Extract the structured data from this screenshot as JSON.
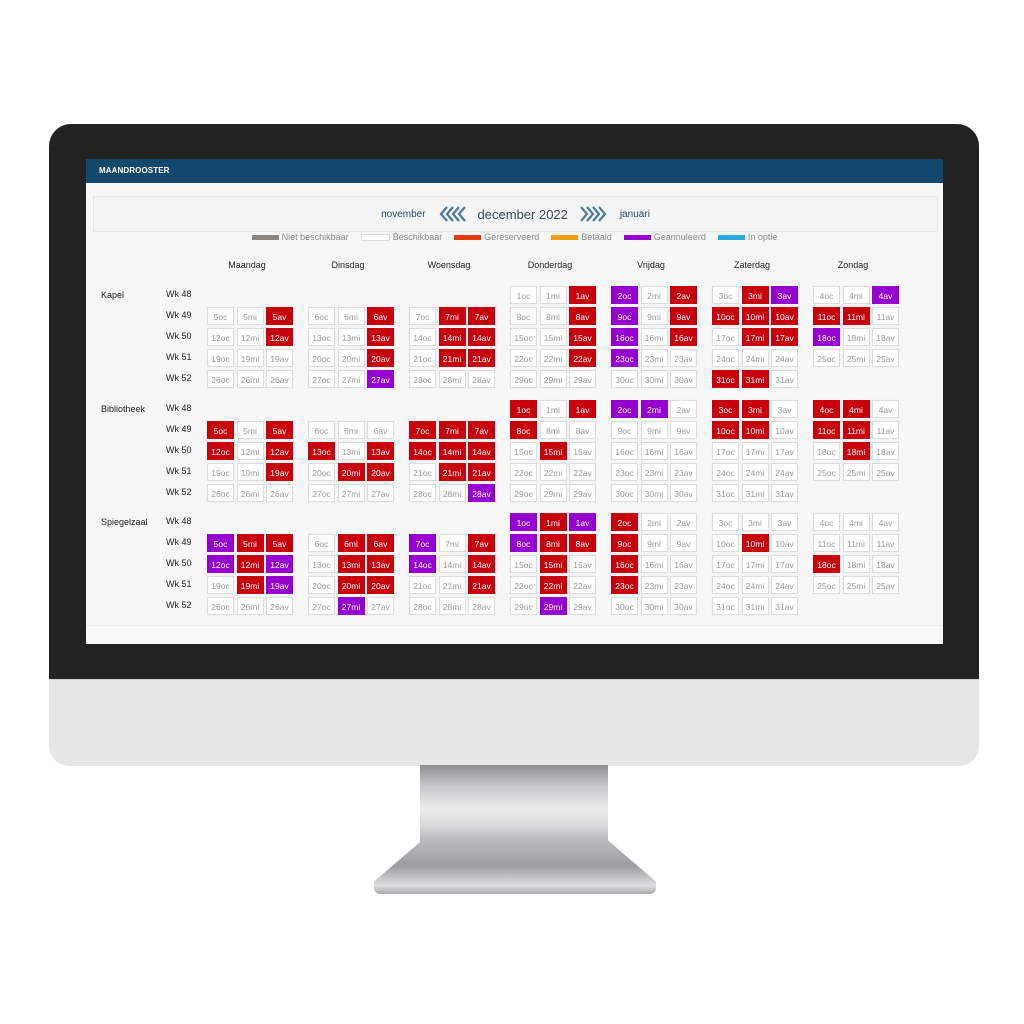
{
  "window": {
    "title": "MAANDROOSTER"
  },
  "navigation": {
    "prev_month": "november",
    "current_month": "december 2022",
    "next_month": "januari",
    "prev_icon": "triple-chevron-left-icon",
    "next_icon": "triple-chevron-right-icon"
  },
  "colors": {
    "header": "#13486e",
    "reserved": "#c8020c",
    "cancelled": "#9500d1"
  },
  "legend": [
    {
      "label": "Niet beschikbaar",
      "color": "#8c8580",
      "status": "unavailable"
    },
    {
      "label": "Beschikbaar",
      "color": "#ffffff",
      "status": "available"
    },
    {
      "label": "Gereserveerd",
      "color": "#e8390e",
      "status": "reserved"
    },
    {
      "label": "Betaald",
      "color": "#f39c12",
      "status": "paid"
    },
    {
      "label": "Geannuleerd",
      "color": "#9500d1",
      "status": "cancelled"
    },
    {
      "label": "In optie",
      "color": "#29abe2",
      "status": "option"
    }
  ],
  "days": [
    "Maandag",
    "Dinsdag",
    "Woensdag",
    "Donderdag",
    "Vrijdag",
    "Zaterdag",
    "Zondag"
  ],
  "slots": [
    "oc",
    "mi",
    "av"
  ],
  "weeks": [
    {
      "label": "Wk 48",
      "dates": [
        null,
        null,
        null,
        1,
        2,
        3,
        4
      ]
    },
    {
      "label": "Wk 49",
      "dates": [
        5,
        6,
        7,
        8,
        9,
        10,
        11
      ]
    },
    {
      "label": "Wk 50",
      "dates": [
        12,
        13,
        14,
        15,
        16,
        17,
        18
      ]
    },
    {
      "label": "Wk 51",
      "dates": [
        19,
        20,
        21,
        22,
        23,
        24,
        25
      ]
    },
    {
      "label": "Wk 52",
      "dates": [
        26,
        27,
        28,
        29,
        30,
        31,
        null
      ]
    }
  ],
  "rooms": [
    {
      "name": "Kapel",
      "reserved": [
        "1av",
        "3mi",
        "2av",
        "5av",
        "6av",
        "7mi",
        "7av",
        "8av",
        "9av",
        "10oc",
        "10mi",
        "10av",
        "11oc",
        "11mi",
        "12av",
        "13av",
        "14mi",
        "14av",
        "15av",
        "16av",
        "17mi",
        "17av",
        "20av",
        "21mi",
        "21av",
        "22av",
        "31oc",
        "31mi"
      ],
      "cancelled": [
        "2oc",
        "3av",
        "4av",
        "9oc",
        "16oc",
        "18oc",
        "23oc",
        "27av"
      ]
    },
    {
      "name": "Bibliotheek",
      "reserved": [
        "1oc",
        "1av",
        "3oc",
        "3mi",
        "4oc",
        "4mi",
        "5oc",
        "5av",
        "7oc",
        "7mi",
        "7av",
        "8oc",
        "10oc",
        "10mi",
        "11oc",
        "11mi",
        "12oc",
        "12av",
        "13oc",
        "13av",
        "14oc",
        "14mi",
        "14av",
        "15mi",
        "18mi",
        "19av",
        "20mi",
        "20av",
        "21mi",
        "21av"
      ],
      "cancelled": [
        "2oc",
        "2mi",
        "28av"
      ]
    },
    {
      "name": "Spiegelzaal",
      "reserved": [
        "1mi",
        "2oc",
        "5mi",
        "5av",
        "6mi",
        "6av",
        "7av",
        "8mi",
        "8av",
        "9oc",
        "10mi",
        "12mi",
        "13mi",
        "13av",
        "14av",
        "15mi",
        "16oc",
        "18oc",
        "19mi",
        "20mi",
        "20av",
        "21av",
        "22mi",
        "23oc"
      ],
      "cancelled": [
        "1oc",
        "1av",
        "5oc",
        "7oc",
        "8oc",
        "12oc",
        "12av",
        "14oc",
        "19av",
        "27mi",
        "29mi"
      ]
    }
  ]
}
